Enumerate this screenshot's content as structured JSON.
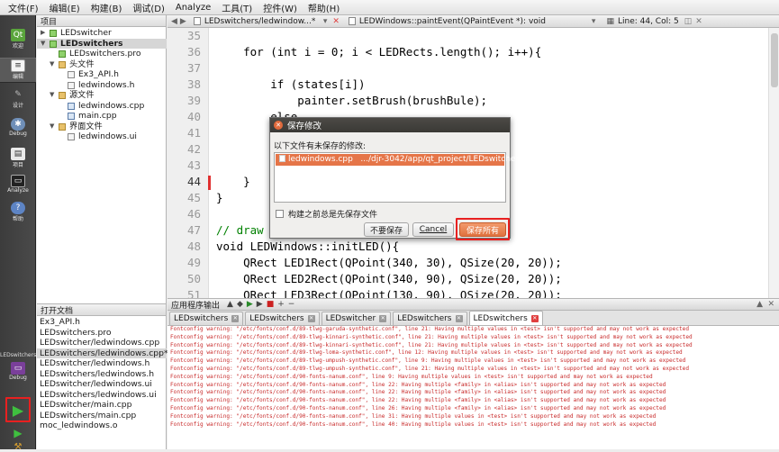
{
  "menu": [
    "文件(F)",
    "编辑(E)",
    "构建(B)",
    "调试(D)",
    "Analyze",
    "工具(T)",
    "控件(W)",
    "帮助(H)"
  ],
  "modes": [
    {
      "label": "欢迎",
      "icon": "welcome-icon"
    },
    {
      "label": "编辑",
      "icon": "edit-icon"
    },
    {
      "label": "设计",
      "icon": "design-icon"
    },
    {
      "label": "Debug",
      "icon": "debug-icon"
    },
    {
      "label": "项目",
      "icon": "projects-icon"
    },
    {
      "label": "Analyze",
      "icon": "analyze-icon"
    },
    {
      "label": "帮助",
      "icon": "help-icon"
    }
  ],
  "kit": {
    "project": "LEDswitchers",
    "mode": "Debug"
  },
  "project_panel": {
    "title": "项目",
    "tree": [
      {
        "label": "LEDswitcher"
      },
      {
        "label": "LEDswitchers"
      },
      {
        "label": "LEDswitchers.pro"
      },
      {
        "label": "头文件"
      },
      {
        "label": "Ex3_API.h"
      },
      {
        "label": "ledwindows.h"
      },
      {
        "label": "源文件"
      },
      {
        "label": "ledwindows.cpp"
      },
      {
        "label": "main.cpp"
      },
      {
        "label": "界面文件"
      },
      {
        "label": "ledwindows.ui"
      }
    ]
  },
  "open_docs": {
    "title": "打开文档",
    "items": [
      "Ex3_API.h",
      "LEDswitchers.pro",
      "LEDswitcher/ledwindows.cpp",
      "LEDswitchers/ledwindows.cpp*",
      "LEDswitcher/ledwindows.h",
      "LEDswitchers/ledwindows.h",
      "LEDswitcher/ledwindows.ui",
      "LEDswitchers/ledwindows.ui",
      "LEDswitcher/main.cpp",
      "LEDswitchers/main.cpp",
      "moc_ledwindows.o"
    ]
  },
  "editor": {
    "file_tab": "LEDswitchers/ledwindow...*",
    "function": "LEDWindows::paintEvent(QPaintEvent *): void",
    "position": "Line: 44, Col: 5",
    "lines": [
      {
        "n": "35",
        "t": ""
      },
      {
        "n": "36",
        "t": "    for (int i = 0; i < LEDRects.length(); i++){"
      },
      {
        "n": "37",
        "t": ""
      },
      {
        "n": "38",
        "t": "        if (states[i])"
      },
      {
        "n": "39",
        "t": "            painter.setBrush(brushBule);"
      },
      {
        "n": "40",
        "t": "        else"
      },
      {
        "n": "41",
        "t": ""
      },
      {
        "n": "42",
        "t": ""
      },
      {
        "n": "43",
        "t": "        p"
      },
      {
        "n": "44",
        "t": "    }"
      },
      {
        "n": "45",
        "t": "}"
      },
      {
        "n": "46",
        "t": ""
      },
      {
        "n": "47",
        "t": "// draw L"
      },
      {
        "n": "48",
        "t": "void LEDWindows::initLED(){"
      },
      {
        "n": "49",
        "t": "    QRect LED1Rect(QPoint(340, 30), QSize(20, 20));"
      },
      {
        "n": "50",
        "t": "    QRect LED2Rect(QPoint(340, 90), QSize(20, 20));"
      },
      {
        "n": "51",
        "t": "    QRect LED3Rect(QPoint(130, 90), QSize(20, 20));"
      }
    ]
  },
  "dialog": {
    "title": "保存修改",
    "message": "以下文件有未保存的修改:",
    "file_name": "ledwindows.cpp",
    "file_path": ".../djr-3042/app/qt_project/LEDswitchers",
    "checkbox": "构建之前总是先保存文件",
    "btn_dont_save": "不要保存",
    "btn_cancel": "Cancel",
    "btn_save_all": "保存所有"
  },
  "output": {
    "title": "应用程序输出",
    "tabs": [
      "LEDswitchers",
      "LEDswitchers",
      "LEDswitcher",
      "LEDswitchers",
      "LEDswitchers"
    ],
    "lines": [
      "Fontconfig warning: \"/etc/fonts/conf.d/89-tlwg-garuda-synthetic.conf\", line 21: Having multiple values in <test> isn't supported and may not work as expected",
      "Fontconfig warning: \"/etc/fonts/conf.d/89-tlwg-kinnari-synthetic.conf\", line 21: Having multiple values in <test> isn't supported and may not work as expected",
      "Fontconfig warning: \"/etc/fonts/conf.d/89-tlwg-kinnari-synthetic.conf\", line 21: Having multiple values in <test> isn't supported and may not work as expected",
      "Fontconfig warning: \"/etc/fonts/conf.d/89-tlwg-loma-synthetic.conf\", line 12: Having multiple values in <test> isn't supported and may not work as expected",
      "Fontconfig warning: \"/etc/fonts/conf.d/89-tlwg-umpush-synthetic.conf\", line 9: Having multiple values in <test> isn't supported and may not work as expected",
      "Fontconfig warning: \"/etc/fonts/conf.d/89-tlwg-umpush-synthetic.conf\", line 21: Having multiple values in <test> isn't supported and may not work as expected",
      "Fontconfig warning: \"/etc/fonts/conf.d/90-fonts-nanum.conf\", line 9: Having multiple values in <test> isn't supported and may not work as expected",
      "Fontconfig warning: \"/etc/fonts/conf.d/90-fonts-nanum.conf\", line 22: Having multiple <family> in <alias> isn't supported and may not work as expected",
      "Fontconfig warning: \"/etc/fonts/conf.d/90-fonts-nanum.conf\", line 22: Having multiple <family> in <alias> isn't supported and may not work as expected",
      "Fontconfig warning: \"/etc/fonts/conf.d/90-fonts-nanum.conf\", line 22: Having multiple <family> in <alias> isn't supported and may not work as expected",
      "Fontconfig warning: \"/etc/fonts/conf.d/90-fonts-nanum.conf\", line 26: Having multiple <family> in <alias> isn't supported and may not work as expected",
      "Fontconfig warning: \"/etc/fonts/conf.d/90-fonts-nanum.conf\", line 31: Having multiple values in <test> isn't supported and may not work as expected",
      "Fontconfig warning: \"/etc/fonts/conf.d/90-fonts-nanum.conf\", line 40: Having multiple values in <test> isn't supported and may not work as expected"
    ]
  }
}
